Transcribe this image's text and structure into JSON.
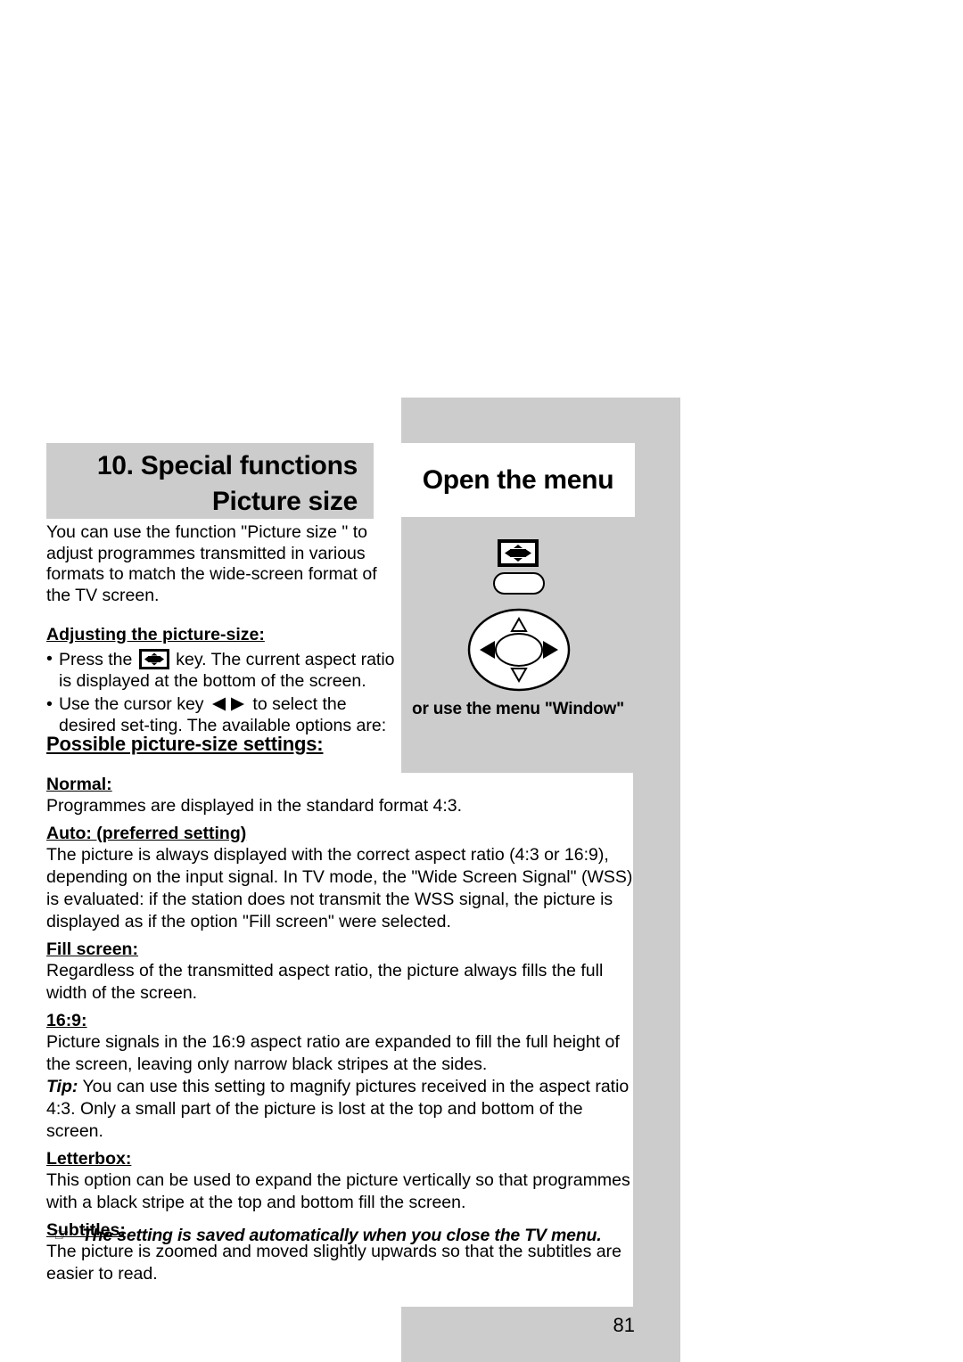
{
  "document": {
    "page_number": "81"
  },
  "header": {
    "chapter_title_line1": "10. Special functions",
    "chapter_title_line2": "Picture size",
    "callout_title": "Open the menu"
  },
  "intro": {
    "paragraph": "You can use the function \"Picture size \" to adjust programmes transmitted in various formats to match the wide-screen format of the TV screen."
  },
  "adjusting": {
    "heading": "Adjusting the picture-size:",
    "bullet_marker": "•",
    "bullet1_before_icon": "Press the",
    "bullet1_after_icon": "key. The current aspect ratio is displayed at the bottom of the screen.",
    "bullet2_before_icon": "Use the cursor key",
    "bullet2_after_icon": "to select the desired set-ting. The available options are:"
  },
  "remote": {
    "picture_size_key_name": "picture-size-key-icon",
    "oval_button_name": "oval-button",
    "dpad_name": "cursor-navigation-pad",
    "menu_hint": "or use the menu \"Window\""
  },
  "settings": {
    "section_heading": "Possible picture-size settings:",
    "items": [
      {
        "name": "Normal:",
        "text": "Programmes are displayed in the standard format 4:3."
      },
      {
        "name": "Auto: (preferred setting)",
        "text": "The picture is always displayed with the correct aspect ratio (4:3 or 16:9), depending on the input signal. In TV mode, the \"Wide Screen Signal\" (WSS) is evaluated: if the station does not transmit the WSS signal, the picture is displayed as if the option \"Fill screen\" were selected."
      },
      {
        "name": "Fill screen:",
        "text": "Regardless of the transmitted aspect ratio, the picture always fills the full width of the screen."
      },
      {
        "name": "16:9:",
        "text": "Picture signals in the 16:9 aspect ratio are expanded to fill the full height of the screen, leaving only narrow black stripes at the sides.",
        "tip_label": "Tip:",
        "tip_text": "You can use this setting to magnify pictures received in the aspect ratio 4:3. Only a small part of the picture is lost at the top and bottom of the screen."
      },
      {
        "name": "Letterbox:",
        "text": "This option can be used to expand the picture vertically so that programmes with a black stripe at the top and bottom fill the screen."
      },
      {
        "name": "Subtitles:",
        "text": "The picture is zoomed and moved slightly upwards so that the subtitles are easier to read."
      }
    ]
  },
  "footnote": {
    "icon": "☞",
    "text": "The setting is saved automatically when you close the TV menu."
  },
  "colors": {
    "gray_block": "#cccccc",
    "text": "#000000",
    "page_background": "#ffffff"
  }
}
